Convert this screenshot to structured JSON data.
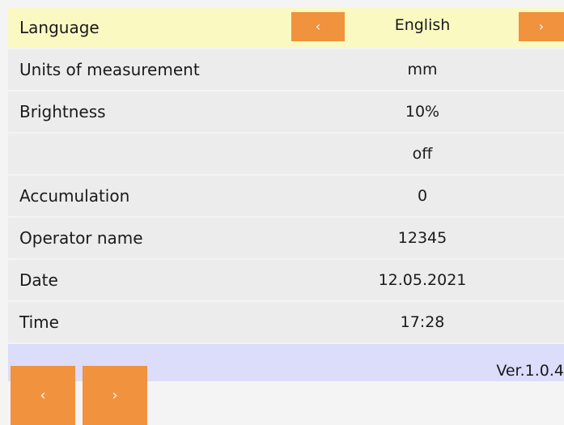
{
  "colors": {
    "accent_button": "#f0923e",
    "row_bg": "#ececec",
    "row_highlight": "#fbf9c2",
    "version_bar": "#dcdcfb",
    "page_bg": "#f4f4f4"
  },
  "settings": {
    "rows": [
      {
        "label": "Language",
        "value": "English"
      },
      {
        "label": "Units of measurement",
        "value": "mm"
      },
      {
        "label": "Brightness",
        "value": "10%"
      },
      {
        "label": "",
        "value": "off"
      },
      {
        "label": "Accumulation",
        "value": "0"
      },
      {
        "label": "Operator name",
        "value": "12345"
      },
      {
        "label": "Date",
        "value": "12.05.2021"
      },
      {
        "label": "Time",
        "value": "17:28"
      }
    ],
    "language_prev_icon": "‹",
    "language_next_icon": "›"
  },
  "footer": {
    "version": "Ver.1.0.4"
  },
  "nav": {
    "prev_icon": "‹",
    "next_icon": "›"
  }
}
